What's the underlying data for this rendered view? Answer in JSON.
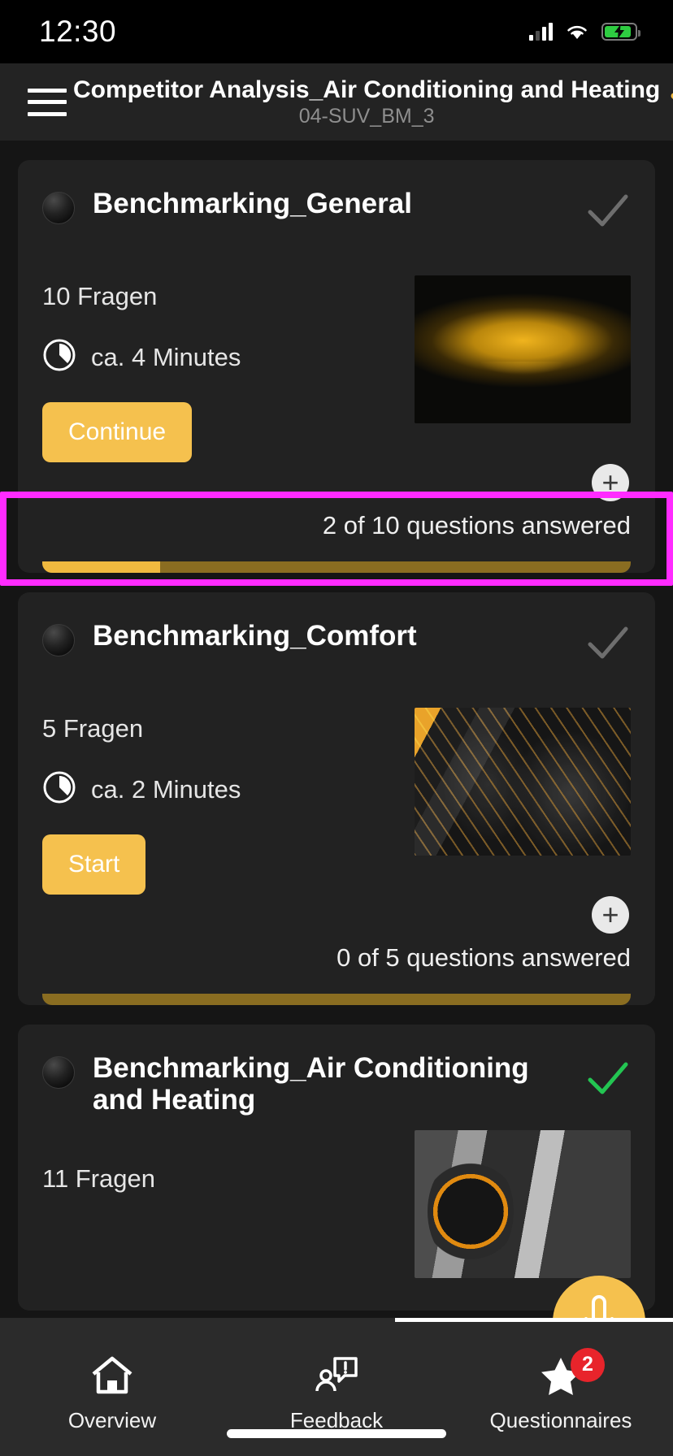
{
  "status_bar": {
    "time": "12:30",
    "signal_icon": "cellular-signal-icon",
    "wifi_icon": "wifi-icon",
    "battery_icon": "battery-charging-icon"
  },
  "header": {
    "menu_icon": "hamburger-menu-icon",
    "title": "Competitor Analysis_Air Conditioning and Heating",
    "subtitle": "04-SUV_BM_3",
    "chevron_icon": "chevron-down-icon",
    "accent_color": "#f0b93f"
  },
  "cards": [
    {
      "title": "Benchmarking_General",
      "status_icon": "checkmark-icon",
      "status_color": "#6e6e6e",
      "question_count": "10 Fragen",
      "duration_icon": "clock-icon",
      "duration": "ca. 4 Minutes",
      "action_label": "Continue",
      "expand_label": "+",
      "progress_text": "2 of 10 questions answered",
      "progress_answered": 2,
      "progress_total": 10,
      "progress_percent": 20,
      "thumbnail": "yellow-sports-car-photo",
      "highlighted": true
    },
    {
      "title": "Benchmarking_Comfort",
      "status_icon": "checkmark-icon",
      "status_color": "#6e6e6e",
      "question_count": "5 Fragen",
      "duration_icon": "clock-icon",
      "duration": "ca. 2 Minutes",
      "action_label": "Start",
      "expand_label": "+",
      "progress_text": "0 of 5 questions answered",
      "progress_answered": 0,
      "progress_total": 5,
      "progress_percent": 0,
      "thumbnail": "car-interior-seats-photo",
      "highlighted": false
    },
    {
      "title": "Benchmarking_Air Conditioning and Heating",
      "status_icon": "checkmark-icon",
      "status_color": "#23c552",
      "question_count": "11 Fragen",
      "thumbnail": "car-dashboard-controls-photo",
      "highlighted": false
    }
  ],
  "fab": {
    "icon": "microphone-icon",
    "color": "#f5c14e"
  },
  "bottom_nav": {
    "items": [
      {
        "label": "Overview",
        "icon": "home-icon",
        "badge": null
      },
      {
        "label": "Feedback",
        "icon": "feedback-person-icon",
        "badge": null
      },
      {
        "label": "Questionnaires",
        "icon": "star-icon",
        "badge": "2"
      }
    ],
    "badge_color": "#e8242b"
  },
  "highlight": {
    "color": "#ff2bff",
    "target": "progress-section-card-1"
  }
}
